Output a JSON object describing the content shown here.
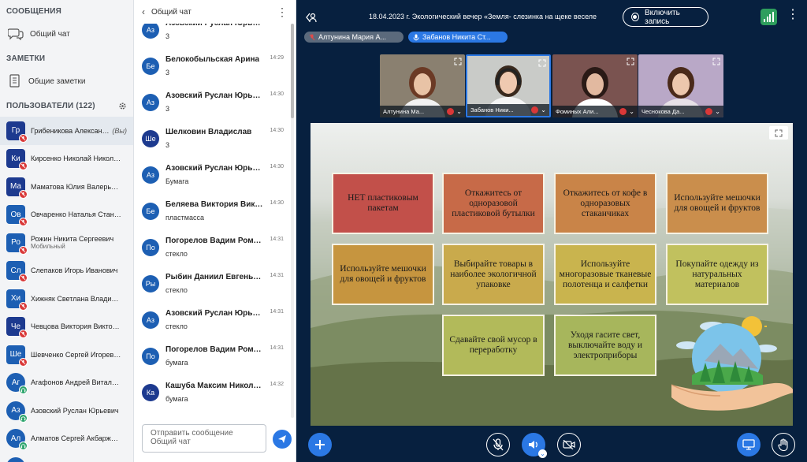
{
  "sidebar": {
    "messages_header": "СООБЩЕНИЯ",
    "public_chat": "Общий чат",
    "notes_header": "ЗАМЕТКИ",
    "shared_notes": "Общие заметки",
    "users_header": "ПОЛЬЗОВАТЕЛИ (122)",
    "users": [
      {
        "initials": "Гр",
        "name": "Грибеникова Александра ...",
        "you": "(Вы)",
        "sub": "",
        "status": "muted",
        "round": false,
        "color": "#1d3a8f"
      },
      {
        "initials": "Ки",
        "name": "Кирсенко Николай Николаевич",
        "sub": "",
        "status": "muted",
        "round": false,
        "color": "#1d3a8f"
      },
      {
        "initials": "Ма",
        "name": "Маматова Юлия Валерьевна",
        "sub": "",
        "status": "muted",
        "round": false,
        "color": "#1d3a8f"
      },
      {
        "initials": "Ов",
        "name": "Овчаренко Наталья Станиславна",
        "sub": "",
        "status": "muted",
        "round": false,
        "color": "#1d5fb3"
      },
      {
        "initials": "Ро",
        "name": "Рожин Никита Сергеевич",
        "sub": "Мобильный",
        "status": "muted",
        "round": false,
        "color": "#1d5fb3"
      },
      {
        "initials": "Сл",
        "name": "Слепаков Игорь Иванович",
        "sub": "",
        "status": "muted",
        "round": false,
        "color": "#1d5fb3"
      },
      {
        "initials": "Хи",
        "name": "Хижняк Светлана Владимировна",
        "sub": "",
        "status": "muted",
        "round": false,
        "color": "#1d5fb3"
      },
      {
        "initials": "Че",
        "name": "Чевцова Виктория Викторовна",
        "sub": "",
        "status": "muted",
        "round": false,
        "color": "#1d3a8f"
      },
      {
        "initials": "Ше",
        "name": "Шевченко Сергей Игоревич",
        "sub": "",
        "status": "muted",
        "round": false,
        "color": "#1d5fb3"
      },
      {
        "initials": "Аг",
        "name": "Агафонов Андрей Витальевич",
        "sub": "",
        "status": "listen",
        "round": true,
        "color": "#1d5fb3"
      },
      {
        "initials": "Аз",
        "name": "Азовский Руслан Юрьевич",
        "sub": "",
        "status": "listen",
        "round": true,
        "color": "#1d5fb3"
      },
      {
        "initials": "Ал",
        "name": "Алматов Сергей Акбаржонович",
        "sub": "",
        "status": "listen",
        "round": true,
        "color": "#1d5fb3"
      },
      {
        "initials": "Ал",
        "name": "Алтунина Мария Андреевна",
        "sub": "",
        "status": "listen",
        "round": true,
        "color": "#1d5fb3"
      }
    ]
  },
  "chat": {
    "back_label": "Общий чат",
    "messages": [
      {
        "initials": "Аз",
        "name": "Азовский Руслан Юрьевич",
        "time": "14:29",
        "text": "3",
        "color": "#1d5fb3"
      },
      {
        "initials": "Бе",
        "name": "Белокобыльская Арина",
        "time": "14:29",
        "text": "3",
        "color": "#1d5fb3"
      },
      {
        "initials": "Аз",
        "name": "Азовский Руслан Юрьевич",
        "time": "14:30",
        "text": "3",
        "color": "#1d5fb3"
      },
      {
        "initials": "Ше",
        "name": "Шелковин Владислав",
        "time": "14:30",
        "text": "3",
        "color": "#1d3a8f"
      },
      {
        "initials": "Аз",
        "name": "Азовский Руслан Юрьевич",
        "time": "14:30",
        "text": "Бумага",
        "color": "#1d5fb3"
      },
      {
        "initials": "Бе",
        "name": "Беляева Виктория Викторовна",
        "time": "14:30",
        "text": "пластмасса",
        "color": "#1d5fb3"
      },
      {
        "initials": "По",
        "name": "Погорелов Вадим Романович",
        "time": "14:31",
        "text": "стекло",
        "color": "#1d5fb3"
      },
      {
        "initials": "Ры",
        "name": "Рыбин Даниил Евгеньевич",
        "time": "14:31",
        "text": "стекло",
        "color": "#1d5fb3"
      },
      {
        "initials": "Аз",
        "name": "Азовский Руслан Юрьевич",
        "time": "14:31",
        "text": "стекло",
        "color": "#1d5fb3"
      },
      {
        "initials": "По",
        "name": "Погорелов Вадим Романович",
        "time": "14:31",
        "text": "бумага",
        "color": "#1d5fb3"
      },
      {
        "initials": "Ка",
        "name": "Кашуба Максим Николаевич",
        "time": "14:32",
        "text": "бумага",
        "color": "#1d3a8f"
      }
    ],
    "input_placeholder": "Отправить сообщение Общий чат"
  },
  "main": {
    "title": "18.04.2023 г. Экологический вечер «Земля- слезинка на щеке веселе",
    "record_label": "Включить запись",
    "talkers": [
      {
        "name": "Алтунина Мария А...",
        "color": "#5b6a7c",
        "icon": "mic-off"
      },
      {
        "name": "Забанов Никита Ст...",
        "color": "#2b78e4",
        "icon": "mic-on"
      }
    ],
    "tiles": [
      {
        "label": "Алтунина Ма...",
        "bg": "#8a8070",
        "hair": "#6b3a25",
        "shirt": "#f2f2f2",
        "skin": "#e8c3a6"
      },
      {
        "label": "Забанов Ники...",
        "bg": "#c9cbc8",
        "hair": "#3a2a1e",
        "shirt": "#f5f5f5",
        "skin": "#efc9b0"
      },
      {
        "label": "Фоминых Али...",
        "bg": "#7a5350",
        "hair": "#2a1a16",
        "shirt": "#ffffff",
        "skin": "#e2b9a0"
      },
      {
        "label": "Чеснокова Да...",
        "bg": "#b9a8c7",
        "hair": "#4a2a1a",
        "shirt": "#e7e1e7",
        "skin": "#ecc7ad"
      }
    ],
    "slide_cards": [
      {
        "text": "НЕТ пластиковым пакетам",
        "color": "#c2504a"
      },
      {
        "text": "Откажитесь от одноразовой пластиковой бутылки",
        "color": "#c76a48"
      },
      {
        "text": "Откажитесь от кофе в одноразовых стаканчиках",
        "color": "#c98448"
      },
      {
        "text": "Используйте мешочки для овощей и фруктов",
        "color": "#ca8e4c"
      },
      {
        "text": "Используйте мешочки для овощей и фруктов",
        "color": "#c6953f"
      },
      {
        "text": "Выбирайте товары в наиболее экологичной упаковке",
        "color": "#c9aa4c"
      },
      {
        "text": "Используйте многоразовые тканевые полотенца и салфетки",
        "color": "#c9b44e"
      },
      {
        "text": "Покупайте одежду из натуральных материалов",
        "color": "#c1c15e"
      },
      {
        "text": "Сдавайте свой мусор в переработку",
        "color": "#b2ba5a"
      },
      {
        "text": "Уходя гасите свет, выключайте воду и электроприборы",
        "color": "#a7b65c"
      }
    ],
    "accent": "#2b78e4"
  }
}
